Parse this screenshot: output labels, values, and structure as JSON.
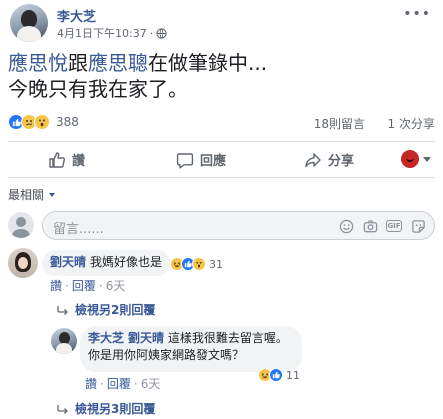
{
  "post": {
    "author": "李大芝",
    "timestamp": "4月1日下午10:37",
    "dot": "·",
    "more_label": "•••",
    "text_line1": {
      "mention1": "應思悅",
      "connector": "跟",
      "mention2": "應思聰",
      "rest": "在做筆錄中..."
    },
    "text_line2": "今晚只有我在家了。"
  },
  "reactions": {
    "icons": [
      "like-icon",
      "sad-icon",
      "wow-icon"
    ],
    "count": "388",
    "comments": "18則留言",
    "shares": "1 次分享"
  },
  "actions": {
    "like": "讚",
    "comment": "回應",
    "share": "分享"
  },
  "sort": {
    "label": "最相關"
  },
  "composer": {
    "placeholder": "留言......"
  },
  "comments": [
    {
      "name": "劉天晴",
      "text": "我媽好像也是",
      "reaction_count": "31",
      "like": "讚",
      "reply": "回覆",
      "time": "6天",
      "sep": "·",
      "replies_link": "檢視另2則回覆"
    },
    {
      "name": "李大芝",
      "mention": "劉天晴",
      "text_line1": "這樣我很難去留言喔。",
      "text_line2": "你是用你阿姨家網路發文嗎？",
      "reaction_count": "11",
      "like": "讚",
      "reply": "回覆",
      "time": "6天",
      "sep": "·",
      "replies_link": "檢視另3則回覆"
    }
  ],
  "colors": {
    "link": "#385898",
    "muted": "#606770",
    "bubble": "#f2f3f5",
    "like_blue": "#2078f4"
  }
}
